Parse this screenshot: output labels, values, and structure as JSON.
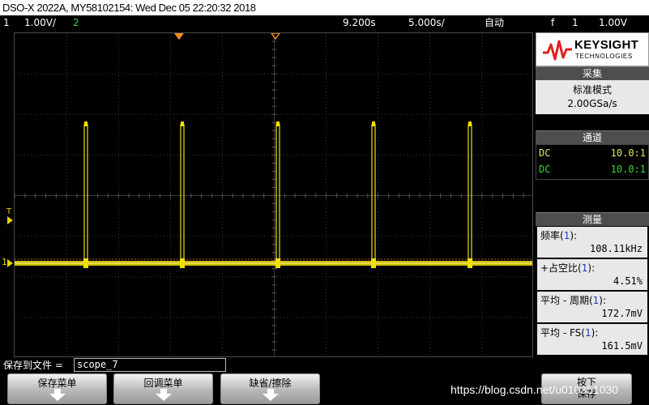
{
  "title": "DSO-X 2022A, MY58102154: Wed Dec 05 22:20:32 2018",
  "status": {
    "ch1_num": "1",
    "ch1_scale": "1.00V/",
    "ch2_num": "2",
    "time_pos": "9.200s",
    "time_scale": "5.000s/",
    "mode": "自动",
    "trig_icon": "trigger-rising-edge-icon",
    "trig_glyph": "f",
    "trig_src": "1",
    "trig_level": "1.00V"
  },
  "markers": {
    "trigger_label": "T",
    "ch1_label": "1"
  },
  "panel": {
    "brand": "KEYSIGHT",
    "brand_sub": "TECHNOLOGIES",
    "acq_head": "采集",
    "acq_mode": "标准模式",
    "acq_rate": "2.00GSa/s",
    "chan_head": "通道",
    "channels": [
      {
        "coupling": "DC",
        "probe": "10.0:1"
      },
      {
        "coupling": "DC",
        "probe": "10.0:1"
      }
    ],
    "meas_head": "测量",
    "measurements": [
      {
        "label": "频率(",
        "src": "1",
        "tail": "):",
        "value": "108.11kHz"
      },
      {
        "label": "+占空比(",
        "src": "1",
        "tail": "):",
        "value": "4.51%"
      },
      {
        "label": "平均 - 周期(",
        "src": "1",
        "tail": "):",
        "value": "172.7mV"
      },
      {
        "label": "平均 - FS(",
        "src": "1",
        "tail": "):",
        "value": "161.5mV"
      }
    ]
  },
  "save": {
    "label": "保存到文件 =",
    "filename": "scope_7"
  },
  "softkeys": [
    {
      "label": "保存菜单"
    },
    {
      "label": "回调菜单"
    },
    {
      "label": "缺省/擦除"
    },
    {
      "label": "按下\n保存"
    }
  ],
  "watermark": "https://blog.csdn.net/u010351030",
  "colors": {
    "ch1": "#e6e65a",
    "ch2": "#35d635",
    "trace": "#f0e000",
    "grid": "#3c3c3c"
  }
}
